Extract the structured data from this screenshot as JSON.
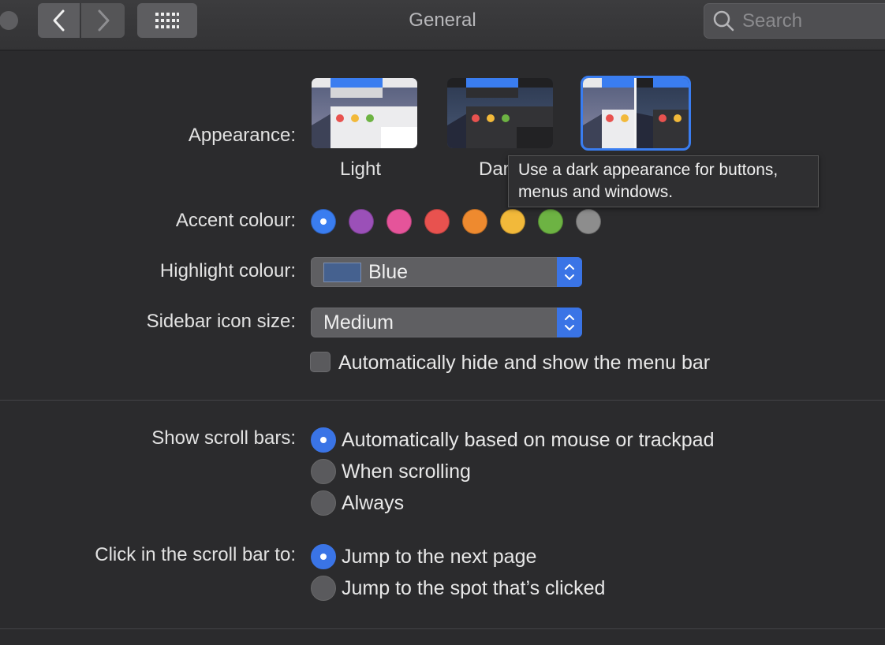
{
  "toolbar": {
    "title": "General",
    "search_placeholder": "Search"
  },
  "appearance": {
    "label": "Appearance:",
    "options": [
      "Light",
      "Dark",
      "Auto"
    ],
    "selected": "Auto",
    "tooltip": "Use a dark appearance for buttons, menus and windows."
  },
  "accent": {
    "label": "Accent colour:",
    "colors": [
      "#3a7df0",
      "#9b50b8",
      "#e5549a",
      "#e8524f",
      "#ee8a2f",
      "#f2b93a",
      "#6db343",
      "#8d8d8d"
    ],
    "selected_index": 0
  },
  "highlight": {
    "label": "Highlight colour:",
    "value": "Blue"
  },
  "sidebar_icon": {
    "label": "Sidebar icon size:",
    "value": "Medium"
  },
  "menubar": {
    "label": "Automatically hide and show the menu bar",
    "checked": false
  },
  "scroll_bars": {
    "label": "Show scroll bars:",
    "options": [
      "Automatically based on mouse or trackpad",
      "When scrolling",
      "Always"
    ],
    "selected_index": 0
  },
  "click_scroll": {
    "label": "Click in the scroll bar to:",
    "options": [
      "Jump to the next page",
      "Jump to the spot that’s clicked"
    ],
    "selected_index": 0
  }
}
